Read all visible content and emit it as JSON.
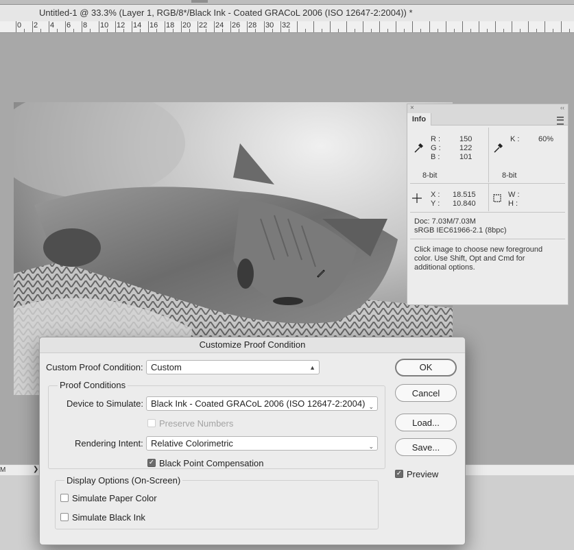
{
  "window": {
    "title": "Untitled-1 @ 33.3% (Layer 1, RGB/8*/Black Ink - Coated GRACoL 2006 (ISO 12647-2:2004)) *"
  },
  "ruler": {
    "labels": [
      "0",
      "2",
      "4",
      "6",
      "8",
      "10",
      "12",
      "14",
      "16",
      "18",
      "20",
      "22",
      "24",
      "26",
      "28",
      "30",
      "32"
    ]
  },
  "status_bar": {
    "zoom_fragment": "M",
    "arrow": "❯"
  },
  "info_panel": {
    "tab": "Info",
    "close_glyph": "×",
    "collapse_glyph": "‹‹",
    "rgb": {
      "r_label": "R :",
      "r": "150",
      "g_label": "G :",
      "g": "122",
      "b_label": "B :",
      "b": "101",
      "bit": "8-bit"
    },
    "cmyk": {
      "k_label": "K :",
      "k": "60%",
      "bit": "8-bit"
    },
    "xy": {
      "x_label": "X :",
      "x": "18.515",
      "y_label": "Y :",
      "y": "10.840"
    },
    "wh": {
      "w_label": "W :",
      "h_label": "H :"
    },
    "doc": "Doc: 7.03M/7.03M",
    "profile": "sRGB IEC61966-2.1 (8bpc)",
    "help": [
      "Click image to choose new foreground",
      "color.  Use Shift, Opt and Cmd for",
      "additional options."
    ]
  },
  "dialog": {
    "title": "Customize Proof Condition",
    "custom_label": "Custom Proof Condition:",
    "custom_value": "Custom",
    "proof_group": "Proof Conditions",
    "device_label": "Device to Simulate:",
    "device_value": "Black Ink - Coated GRACoL 2006 (ISO 12647-2:2004)",
    "preserve_label": "Preserve Numbers",
    "intent_label": "Rendering Intent:",
    "intent_value": "Relative Colorimetric",
    "bpc_label": "Black Point Compensation",
    "display_group": "Display Options (On-Screen)",
    "paper_label": "Simulate Paper Color",
    "black_ink_label": "Simulate Black Ink",
    "ok": "OK",
    "cancel": "Cancel",
    "load": "Load...",
    "save": "Save...",
    "preview_label": "Preview",
    "check_glyph": "✓"
  }
}
